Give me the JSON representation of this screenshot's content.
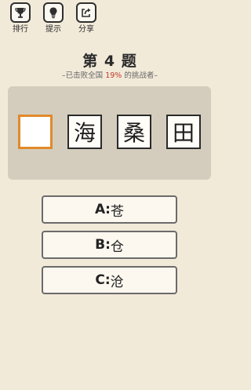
{
  "toolbar": {
    "items": [
      {
        "label": "排行",
        "icon": "trophy-icon"
      },
      {
        "label": "提示",
        "icon": "lightbulb-icon"
      },
      {
        "label": "分享",
        "icon": "share-icon"
      }
    ]
  },
  "level": {
    "title": "第 4 题",
    "subtitle_prefix": "–已击败全国 ",
    "percent": "19%",
    "subtitle_suffix": " 的挑战者–"
  },
  "puzzle": {
    "cells": [
      "",
      "海",
      "桑",
      "田"
    ],
    "blank_index": 0
  },
  "options": [
    {
      "letter": "A",
      "sep": ":",
      "char": "苍"
    },
    {
      "letter": "B",
      "sep": ":",
      "char": "仓"
    },
    {
      "letter": "C",
      "sep": ":",
      "char": "沧"
    }
  ],
  "colors": {
    "background": "#f2ead9",
    "panel": "#d4cdbd",
    "blank_border": "#e08a2b",
    "percent": "#c0392b"
  }
}
